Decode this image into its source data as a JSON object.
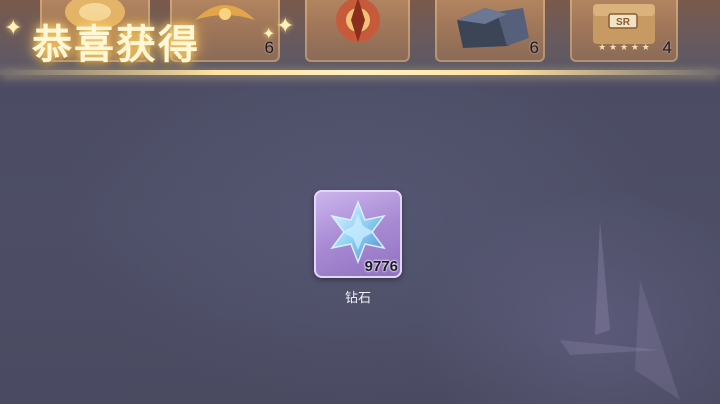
{
  "header": {
    "title": "恭喜获得",
    "title_color": "#fff7d8",
    "glow_color": "#ffd66e"
  },
  "reward_strip": {
    "slots": [
      {
        "icon": "gold-ornament-icon",
        "count": ""
      },
      {
        "icon": "golden-bird-icon",
        "count": "6"
      },
      {
        "icon": "red-crest-emblem-icon",
        "count": ""
      },
      {
        "icon": "dark-stone-icon",
        "count": "6"
      },
      {
        "icon": "sr-treasure-chest-icon",
        "count": "4",
        "badge": "SR"
      }
    ]
  },
  "reward_item": {
    "name": "钻石",
    "count": "9776",
    "icon": "blue-crystal-star-icon",
    "frame_color": "#a88ad3"
  }
}
